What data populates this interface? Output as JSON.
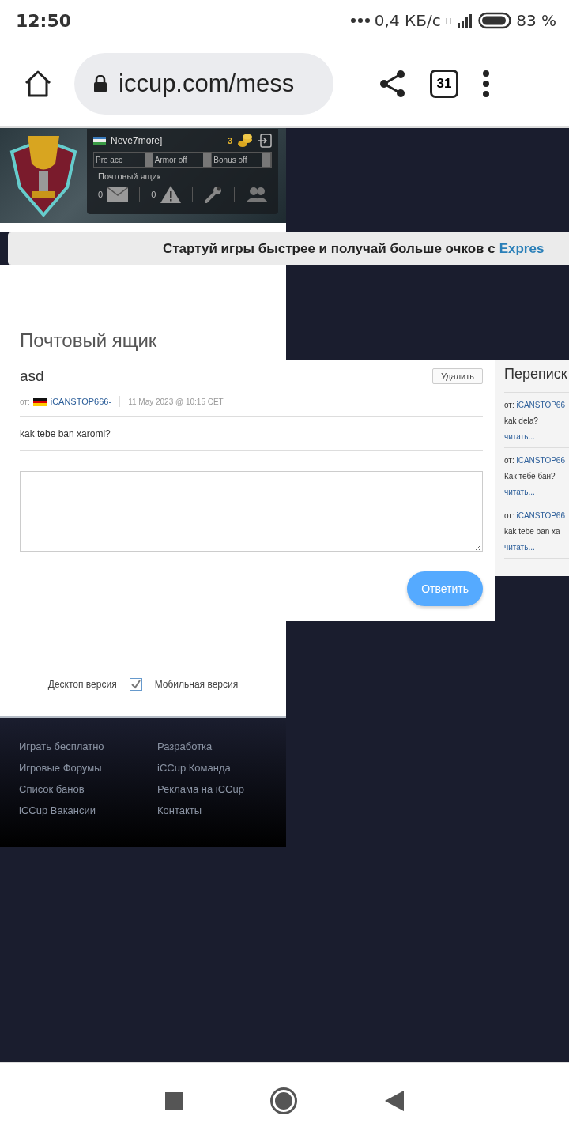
{
  "status_bar": {
    "time": "12:50",
    "speed": "0,4 КБ/с",
    "network": "H",
    "battery": "83 %"
  },
  "browser": {
    "url": "iccup.com/mess",
    "tab_count": "31"
  },
  "header": {
    "username": "Neve7more]",
    "coins": "3",
    "toggles": [
      {
        "label": "Pro acc",
        "on": false
      },
      {
        "label": "Armor off",
        "on": false
      },
      {
        "label": "Bonus off",
        "on": false
      }
    ],
    "mailbox_label": "Почтовый ящик",
    "mail_count": "0",
    "alert_count": "0"
  },
  "banner": {
    "text": "Стартуй игры быстрее и получай больше очков с",
    "link": "Expres"
  },
  "page_title": "Почтовый ящик",
  "message": {
    "subject": "asd",
    "delete_button": "Удалить",
    "from_label": "от:",
    "sender": "iCANSTOP666-",
    "date": "11 May 2023 @ 10:15 CET",
    "body": "kak tebe ban xaromi?",
    "reply_button": "Ответить"
  },
  "sidebar": {
    "title": "Переписк",
    "items": [
      {
        "from_label": "от:",
        "sender": "iCANSTOP66",
        "preview": "kak dela?",
        "read_link": "читать..."
      },
      {
        "from_label": "от:",
        "sender": "iCANSTOP66",
        "preview": "Как тебе бан?",
        "read_link": "читать..."
      },
      {
        "from_label": "от:",
        "sender": "iCANSTOP66",
        "preview": "kak tebe ban xa",
        "read_link": "читать..."
      }
    ]
  },
  "version_switch": {
    "desktop_label": "Десктоп версия",
    "mobile_label": "Мобильная версия",
    "checked": true
  },
  "footer": {
    "columns": [
      [
        "Играть бесплатно",
        "Игровые Форумы",
        "Список банов",
        "iCCup Вакансии"
      ],
      [
        "Разработка",
        "iCCup Команда",
        "Реклама на iCCup",
        "Контакты"
      ]
    ]
  }
}
